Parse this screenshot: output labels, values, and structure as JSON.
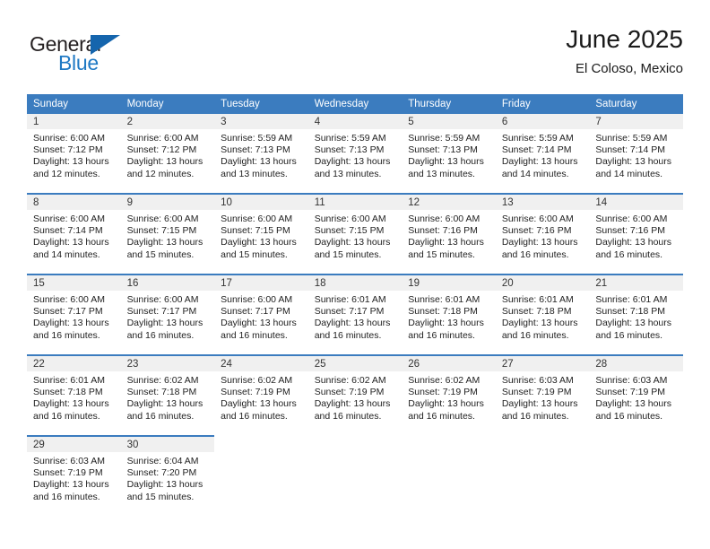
{
  "brand": {
    "name_part1": "General",
    "name_part2": "Blue",
    "triangle_icon": "triangle-logo-icon",
    "color_dark": "#231f20",
    "color_blue": "#1f79c4"
  },
  "header": {
    "title": "June 2025",
    "subtitle": "El Coloso, Mexico"
  },
  "theme": {
    "header_blue": "#3b7cbf",
    "daynum_band": "#f0f0f0",
    "text": "#222222"
  },
  "weekdays": [
    "Sunday",
    "Monday",
    "Tuesday",
    "Wednesday",
    "Thursday",
    "Friday",
    "Saturday"
  ],
  "weeks": [
    [
      {
        "day": "1",
        "sunrise": "Sunrise: 6:00 AM",
        "sunset": "Sunset: 7:12 PM",
        "daylight1": "Daylight: 13 hours",
        "daylight2": "and 12 minutes."
      },
      {
        "day": "2",
        "sunrise": "Sunrise: 6:00 AM",
        "sunset": "Sunset: 7:12 PM",
        "daylight1": "Daylight: 13 hours",
        "daylight2": "and 12 minutes."
      },
      {
        "day": "3",
        "sunrise": "Sunrise: 5:59 AM",
        "sunset": "Sunset: 7:13 PM",
        "daylight1": "Daylight: 13 hours",
        "daylight2": "and 13 minutes."
      },
      {
        "day": "4",
        "sunrise": "Sunrise: 5:59 AM",
        "sunset": "Sunset: 7:13 PM",
        "daylight1": "Daylight: 13 hours",
        "daylight2": "and 13 minutes."
      },
      {
        "day": "5",
        "sunrise": "Sunrise: 5:59 AM",
        "sunset": "Sunset: 7:13 PM",
        "daylight1": "Daylight: 13 hours",
        "daylight2": "and 13 minutes."
      },
      {
        "day": "6",
        "sunrise": "Sunrise: 5:59 AM",
        "sunset": "Sunset: 7:14 PM",
        "daylight1": "Daylight: 13 hours",
        "daylight2": "and 14 minutes."
      },
      {
        "day": "7",
        "sunrise": "Sunrise: 5:59 AM",
        "sunset": "Sunset: 7:14 PM",
        "daylight1": "Daylight: 13 hours",
        "daylight2": "and 14 minutes."
      }
    ],
    [
      {
        "day": "8",
        "sunrise": "Sunrise: 6:00 AM",
        "sunset": "Sunset: 7:14 PM",
        "daylight1": "Daylight: 13 hours",
        "daylight2": "and 14 minutes."
      },
      {
        "day": "9",
        "sunrise": "Sunrise: 6:00 AM",
        "sunset": "Sunset: 7:15 PM",
        "daylight1": "Daylight: 13 hours",
        "daylight2": "and 15 minutes."
      },
      {
        "day": "10",
        "sunrise": "Sunrise: 6:00 AM",
        "sunset": "Sunset: 7:15 PM",
        "daylight1": "Daylight: 13 hours",
        "daylight2": "and 15 minutes."
      },
      {
        "day": "11",
        "sunrise": "Sunrise: 6:00 AM",
        "sunset": "Sunset: 7:15 PM",
        "daylight1": "Daylight: 13 hours",
        "daylight2": "and 15 minutes."
      },
      {
        "day": "12",
        "sunrise": "Sunrise: 6:00 AM",
        "sunset": "Sunset: 7:16 PM",
        "daylight1": "Daylight: 13 hours",
        "daylight2": "and 15 minutes."
      },
      {
        "day": "13",
        "sunrise": "Sunrise: 6:00 AM",
        "sunset": "Sunset: 7:16 PM",
        "daylight1": "Daylight: 13 hours",
        "daylight2": "and 16 minutes."
      },
      {
        "day": "14",
        "sunrise": "Sunrise: 6:00 AM",
        "sunset": "Sunset: 7:16 PM",
        "daylight1": "Daylight: 13 hours",
        "daylight2": "and 16 minutes."
      }
    ],
    [
      {
        "day": "15",
        "sunrise": "Sunrise: 6:00 AM",
        "sunset": "Sunset: 7:17 PM",
        "daylight1": "Daylight: 13 hours",
        "daylight2": "and 16 minutes."
      },
      {
        "day": "16",
        "sunrise": "Sunrise: 6:00 AM",
        "sunset": "Sunset: 7:17 PM",
        "daylight1": "Daylight: 13 hours",
        "daylight2": "and 16 minutes."
      },
      {
        "day": "17",
        "sunrise": "Sunrise: 6:00 AM",
        "sunset": "Sunset: 7:17 PM",
        "daylight1": "Daylight: 13 hours",
        "daylight2": "and 16 minutes."
      },
      {
        "day": "18",
        "sunrise": "Sunrise: 6:01 AM",
        "sunset": "Sunset: 7:17 PM",
        "daylight1": "Daylight: 13 hours",
        "daylight2": "and 16 minutes."
      },
      {
        "day": "19",
        "sunrise": "Sunrise: 6:01 AM",
        "sunset": "Sunset: 7:18 PM",
        "daylight1": "Daylight: 13 hours",
        "daylight2": "and 16 minutes."
      },
      {
        "day": "20",
        "sunrise": "Sunrise: 6:01 AM",
        "sunset": "Sunset: 7:18 PM",
        "daylight1": "Daylight: 13 hours",
        "daylight2": "and 16 minutes."
      },
      {
        "day": "21",
        "sunrise": "Sunrise: 6:01 AM",
        "sunset": "Sunset: 7:18 PM",
        "daylight1": "Daylight: 13 hours",
        "daylight2": "and 16 minutes."
      }
    ],
    [
      {
        "day": "22",
        "sunrise": "Sunrise: 6:01 AM",
        "sunset": "Sunset: 7:18 PM",
        "daylight1": "Daylight: 13 hours",
        "daylight2": "and 16 minutes."
      },
      {
        "day": "23",
        "sunrise": "Sunrise: 6:02 AM",
        "sunset": "Sunset: 7:18 PM",
        "daylight1": "Daylight: 13 hours",
        "daylight2": "and 16 minutes."
      },
      {
        "day": "24",
        "sunrise": "Sunrise: 6:02 AM",
        "sunset": "Sunset: 7:19 PM",
        "daylight1": "Daylight: 13 hours",
        "daylight2": "and 16 minutes."
      },
      {
        "day": "25",
        "sunrise": "Sunrise: 6:02 AM",
        "sunset": "Sunset: 7:19 PM",
        "daylight1": "Daylight: 13 hours",
        "daylight2": "and 16 minutes."
      },
      {
        "day": "26",
        "sunrise": "Sunrise: 6:02 AM",
        "sunset": "Sunset: 7:19 PM",
        "daylight1": "Daylight: 13 hours",
        "daylight2": "and 16 minutes."
      },
      {
        "day": "27",
        "sunrise": "Sunrise: 6:03 AM",
        "sunset": "Sunset: 7:19 PM",
        "daylight1": "Daylight: 13 hours",
        "daylight2": "and 16 minutes."
      },
      {
        "day": "28",
        "sunrise": "Sunrise: 6:03 AM",
        "sunset": "Sunset: 7:19 PM",
        "daylight1": "Daylight: 13 hours",
        "daylight2": "and 16 minutes."
      }
    ],
    [
      {
        "day": "29",
        "sunrise": "Sunrise: 6:03 AM",
        "sunset": "Sunset: 7:19 PM",
        "daylight1": "Daylight: 13 hours",
        "daylight2": "and 16 minutes."
      },
      {
        "day": "30",
        "sunrise": "Sunrise: 6:04 AM",
        "sunset": "Sunset: 7:20 PM",
        "daylight1": "Daylight: 13 hours",
        "daylight2": "and 15 minutes."
      },
      {
        "day": "",
        "sunrise": "",
        "sunset": "",
        "daylight1": "",
        "daylight2": ""
      },
      {
        "day": "",
        "sunrise": "",
        "sunset": "",
        "daylight1": "",
        "daylight2": ""
      },
      {
        "day": "",
        "sunrise": "",
        "sunset": "",
        "daylight1": "",
        "daylight2": ""
      },
      {
        "day": "",
        "sunrise": "",
        "sunset": "",
        "daylight1": "",
        "daylight2": ""
      },
      {
        "day": "",
        "sunrise": "",
        "sunset": "",
        "daylight1": "",
        "daylight2": ""
      }
    ]
  ]
}
